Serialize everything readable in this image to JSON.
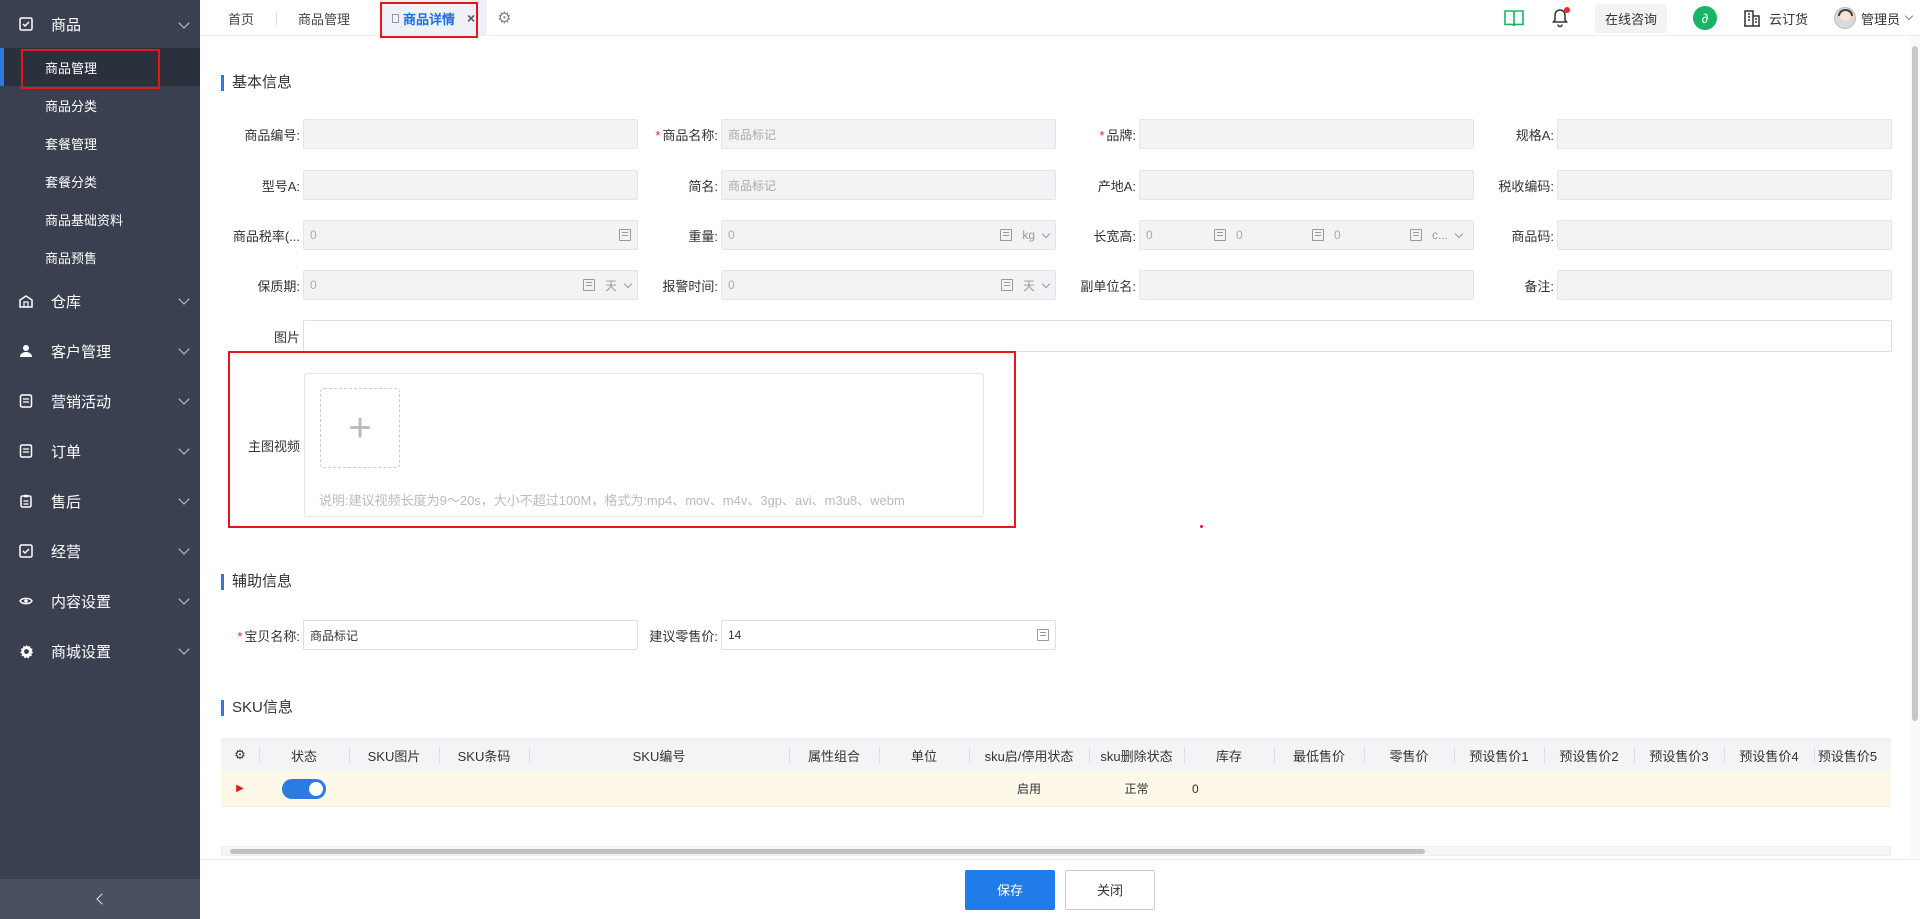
{
  "sidebar": {
    "groups": [
      {
        "label": "商品",
        "icon": "checkbox-icon"
      },
      {
        "label": "仓库",
        "icon": "warehouse-icon"
      },
      {
        "label": "客户管理",
        "icon": "user-icon"
      },
      {
        "label": "营销活动",
        "icon": "list-icon"
      },
      {
        "label": "订单",
        "icon": "list-icon"
      },
      {
        "label": "售后",
        "icon": "clipboard-icon"
      },
      {
        "label": "经营",
        "icon": "checkbox-icon"
      },
      {
        "label": "内容设置",
        "icon": "eye-icon"
      },
      {
        "label": "商城设置",
        "icon": "gear-icon"
      }
    ],
    "sub_items": [
      "商品管理",
      "商品分类",
      "套餐管理",
      "套餐分类",
      "商品基础资料",
      "商品预售"
    ]
  },
  "tabs": {
    "home": "首页",
    "product_mgmt": "商品管理",
    "product_detail": "商品详情",
    "close": "×"
  },
  "topbar": {
    "consult": "在线咨询",
    "cloud_order": "云订货",
    "admin": "管理员"
  },
  "basic": {
    "title": "基本信息",
    "code_label": "商品编号:",
    "name_label": "商品名称:",
    "name_placeholder": "商品标记",
    "brand_label": "品牌:",
    "spec_label": "规格A:",
    "model_label": "型号A:",
    "short_label": "简名:",
    "short_placeholder": "商品标记",
    "origin_label": "产地A:",
    "tax_code_label": "税收编码:",
    "tax_rate_label": "商品税率(...",
    "tax_rate_value": "0",
    "weight_label": "重量:",
    "weight_value": "0",
    "weight_unit": "kg",
    "dims_label": "长宽高:",
    "dims_values": [
      "0",
      "0",
      "0"
    ],
    "dims_unit": "c...",
    "barcode_label": "商品码:",
    "shelf_label": "保质期:",
    "shelf_value": "0",
    "shelf_unit": "天",
    "alarm_label": "报警时间:",
    "alarm_value": "0",
    "alarm_unit": "天",
    "sub_unit_label": "副单位名:",
    "remark_label": "备注:",
    "image_label": "图片",
    "video_label": "主图视频",
    "video_hint": "说明:建议视频长度为9～20s，大小不超过100M，格式为:mp4、mov、m4v、3gp、avi、m3u8、webm"
  },
  "aux": {
    "title": "辅助信息",
    "baby_name_label": "宝贝名称:",
    "baby_name_value": "商品标记",
    "retail_label": "建议零售价:",
    "retail_value": "14"
  },
  "sku": {
    "title": "SKU信息",
    "columns": [
      "状态",
      "SKU图片",
      "SKU条码",
      "SKU编号",
      "属性组合",
      "单位",
      "sku启/停用状态",
      "sku删除状态",
      "库存",
      "最低售价",
      "零售价",
      "预设售价1",
      "预设售价2",
      "预设售价3",
      "预设售价4",
      "预设售价5"
    ],
    "row": {
      "status_enabled": true,
      "enable_state": "启用",
      "delete_state": "正常",
      "stock": "0"
    }
  },
  "footer": {
    "save": "保存",
    "close": "关闭"
  }
}
